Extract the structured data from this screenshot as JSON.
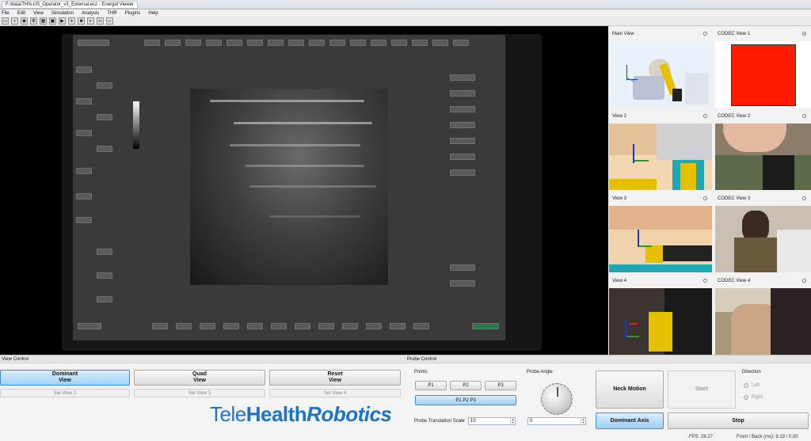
{
  "window": {
    "tabs": [
      "F:/data/THN-US_Operator_v3_External.ecz - Energid Viewer"
    ],
    "title": ""
  },
  "menu": [
    "File",
    "Edit",
    "View",
    "Simulation",
    "Analysis",
    "THR",
    "Plugins",
    "Help"
  ],
  "views": {
    "main_view": "Main View",
    "codec1": "CODEC View 1",
    "view2": "View 2",
    "codec2": "CODEC View 2",
    "view3": "View 3",
    "codec3": "CODEC View 3",
    "view4": "View 4",
    "codec4": "CODEC View 4"
  },
  "view_control": {
    "header": "View Control",
    "dominant": [
      "Dominant",
      "View"
    ],
    "quad": [
      "Quad",
      "View"
    ],
    "reset": [
      "Reset",
      "View"
    ],
    "set2": "Set View 2",
    "set3": "Set View 3",
    "set4": "Set View 4"
  },
  "probe_control": {
    "header": "Probe Control",
    "points_label": "Points",
    "p1": "P1",
    "p2": "P2",
    "p3": "P3",
    "p123": "P1 P2 P3",
    "angle_label": "Probe Angle",
    "scale_label": "Probe Translation Scale",
    "scale_value": "10",
    "angle_value": "0",
    "neck_motion": "Neck Motion",
    "start": "Start",
    "dominant_axis": "Dominant Axis",
    "stop": "Stop",
    "direction_label": "Direction",
    "left": "Left",
    "right": "Right"
  },
  "logo": {
    "tele": "Tele",
    "health": "Health",
    "robotics": "Robotics"
  },
  "status": {
    "fps": "FPS: 28.27",
    "front_back": "Front / Back (ms): 9.19 / 0.00"
  },
  "colors": {
    "accent_blue": "#1d74c4",
    "codec_red": "#ff1a00"
  }
}
